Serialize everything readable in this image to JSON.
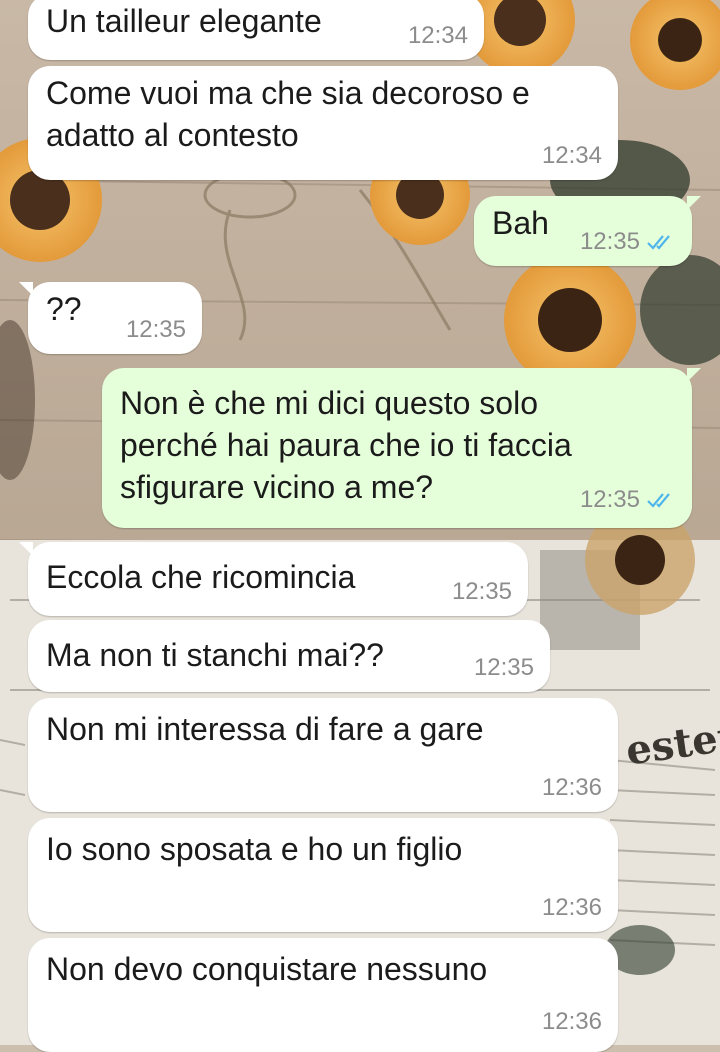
{
  "theme": {
    "incoming_bg": "#ffffff",
    "outgoing_bg": "#e6ffdb",
    "text_color": "#1b1b1b",
    "time_color": "#8c8c8c",
    "read_tick_color": "#4fb6ec"
  },
  "wallpaper": {
    "description_icons": [
      "sunflower-icon",
      "newspaper-icon",
      "twine-icon"
    ],
    "newspaper_text": "ester"
  },
  "messages": [
    {
      "direction": "in",
      "text": "Un tailleur elegante",
      "time": "12:34"
    },
    {
      "direction": "in",
      "text": "Come vuoi ma che sia decoroso e\nadatto al contesto",
      "time": "12:34"
    },
    {
      "direction": "out",
      "text": "Bah",
      "time": "12:35",
      "status": "read"
    },
    {
      "direction": "in",
      "text": "??",
      "time": "12:35"
    },
    {
      "direction": "out",
      "text": "Non è che mi dici questo solo\nperché hai paura che io ti faccia\nsfigurare vicino a me?",
      "time": "12:35",
      "status": "read"
    },
    {
      "direction": "in",
      "text": "Eccola che ricomincia",
      "time": "12:35"
    },
    {
      "direction": "in",
      "text": "Ma non ti stanchi mai??",
      "time": "12:35"
    },
    {
      "direction": "in",
      "text": "Non mi interessa di fare a gare",
      "time": "12:36"
    },
    {
      "direction": "in",
      "text": "Io sono sposata e ho un figlio",
      "time": "12:36"
    },
    {
      "direction": "in",
      "text": "Non devo conquistare nessuno",
      "time": "12:36"
    }
  ]
}
